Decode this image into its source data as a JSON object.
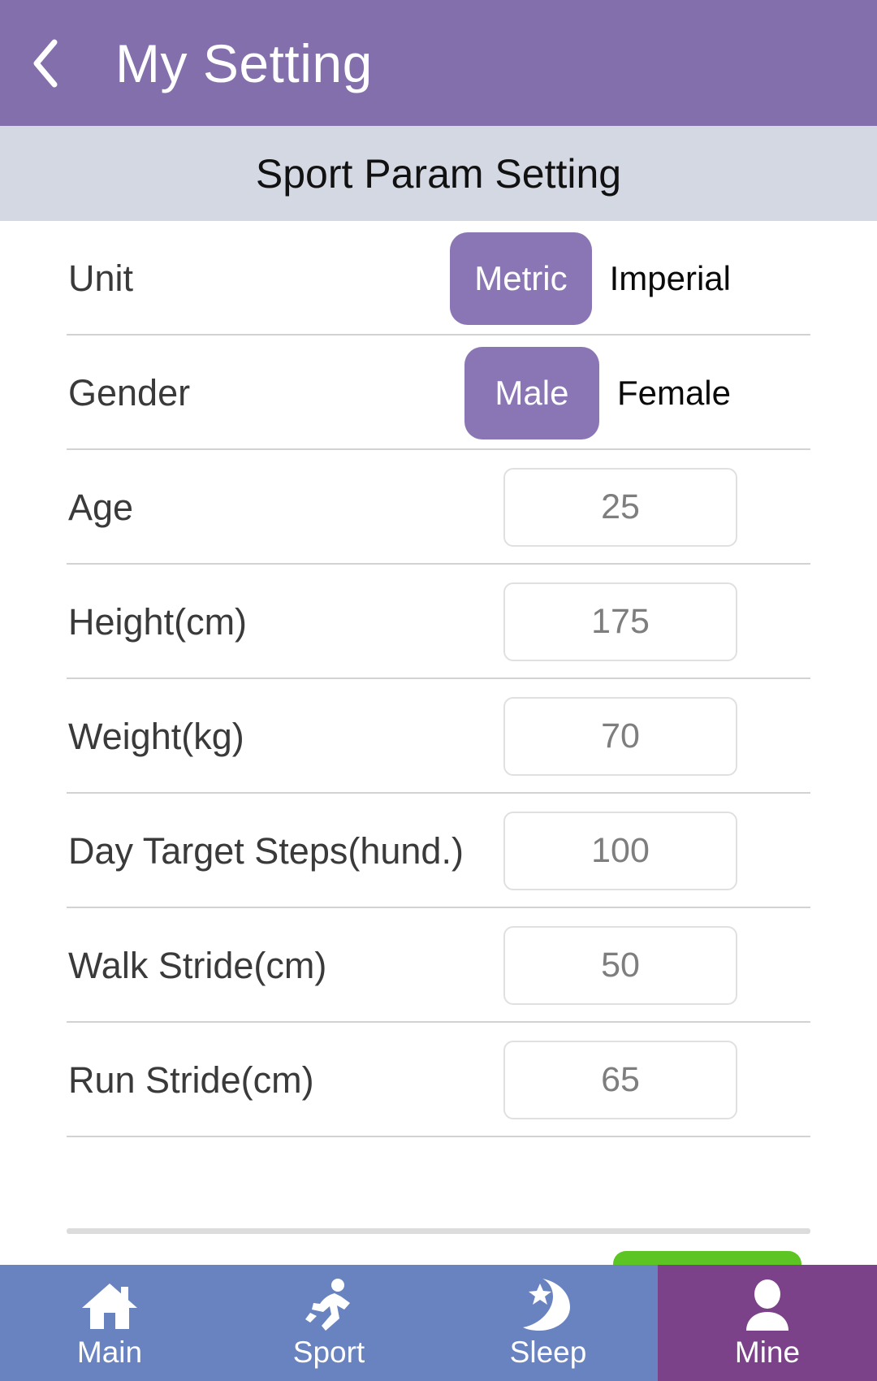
{
  "appbar": {
    "back_icon": "chevron-left-icon",
    "title": "My Setting"
  },
  "subheader": {
    "title": "Sport Param Setting"
  },
  "settings": {
    "rows": [
      {
        "label": "Unit",
        "type": "segmented",
        "options": [
          "Metric",
          "Imperial"
        ],
        "selected": "Metric"
      },
      {
        "label": "Gender",
        "type": "segmented",
        "options": [
          "Male",
          "Female"
        ],
        "selected": "Male"
      },
      {
        "label": "Age",
        "type": "number",
        "value": "25"
      },
      {
        "label": "Height(cm)",
        "type": "number",
        "value": "175"
      },
      {
        "label": "Weight(kg)",
        "type": "number",
        "value": "70"
      },
      {
        "label": "Day Target Steps(hund.)",
        "type": "number",
        "value": "100"
      },
      {
        "label": "Walk Stride(cm)",
        "type": "number",
        "value": "50"
      },
      {
        "label": "Run Stride(cm)",
        "type": "number",
        "value": "65"
      }
    ]
  },
  "save_button": {
    "label": ""
  },
  "bottomnav": {
    "items": [
      {
        "label": "Main",
        "icon": "home-icon",
        "selected": false
      },
      {
        "label": "Sport",
        "icon": "running-person-icon",
        "selected": false
      },
      {
        "label": "Sleep",
        "icon": "moon-star-icon",
        "selected": false
      },
      {
        "label": "Mine",
        "icon": "person-icon",
        "selected": true
      }
    ]
  },
  "colors": {
    "appbar_purple": "#836FAB",
    "subheader_gray": "#D3D8E2",
    "toggle_purple": "#8A76B4",
    "nav_blue": "#6982C0",
    "nav_selected_purple": "#7C4289",
    "save_green": "#5CC523",
    "input_border": "#E0E0E0",
    "divider": "#D2D2D2"
  }
}
